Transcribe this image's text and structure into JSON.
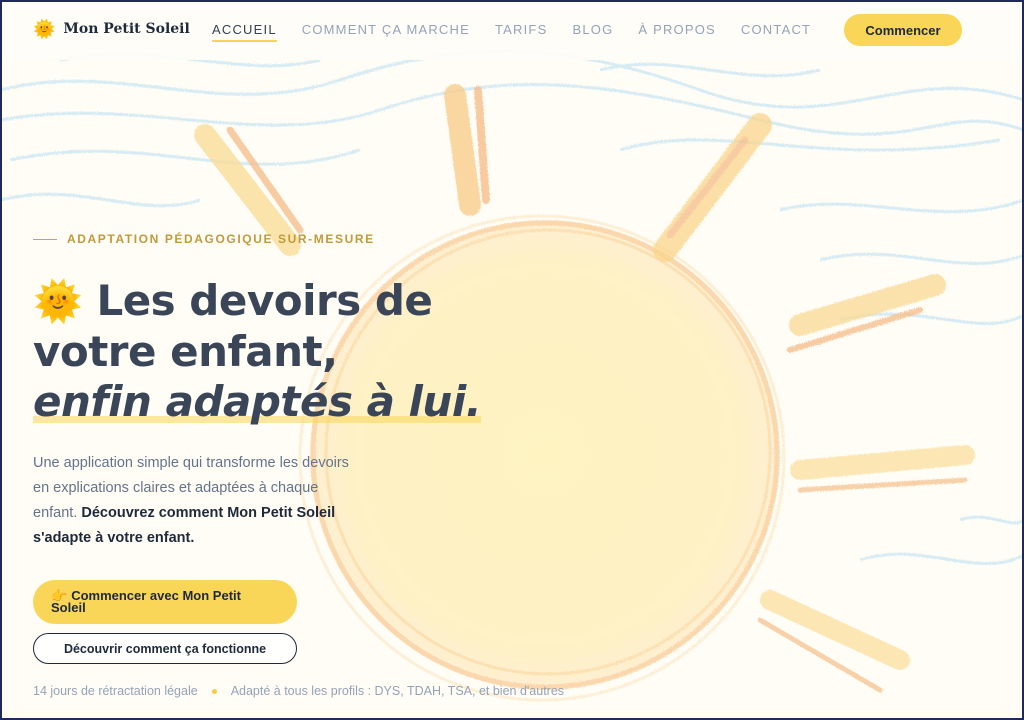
{
  "brand": {
    "icon": "🌞",
    "name": "Mon Petit Soleil"
  },
  "nav": {
    "links": [
      "ACCUEIL",
      "COMMENT ÇA MARCHE",
      "TARIFS",
      "BLOG",
      "À PROPOS",
      "CONTACT"
    ],
    "active_index": 0,
    "cta_label": "Commencer"
  },
  "hero": {
    "eyebrow": "ADAPTATION PÉDAGOGIQUE SUR-MESURE",
    "headline_emoji": "🌞",
    "headline_line1": "Les devoirs de",
    "headline_line2": "votre enfant,",
    "headline_line3": "enfin adaptés à lui.",
    "description": "Une application simple qui transforme les devoirs en explications claires et adaptées à chaque enfant.",
    "description_strong": "Découvrez comment Mon Petit Soleil s'adapte à votre enfant.",
    "primary_icon": "👉",
    "primary_cta": "Commencer avec Mon Petit Soleil",
    "secondary_cta": "Découvrir comment ça fonctionne",
    "footnote_1": "14 jours de rétractation légale",
    "footnote_2": "Adapté à tous les profils : DYS, TDAH, TSA, et bien d'autres"
  },
  "colors": {
    "accent": "#f9d558",
    "heading": "#3a4658",
    "eyebrow": "#c19a3c",
    "sky": "#7cc3ea",
    "sun_orange": "#f4a24a"
  }
}
